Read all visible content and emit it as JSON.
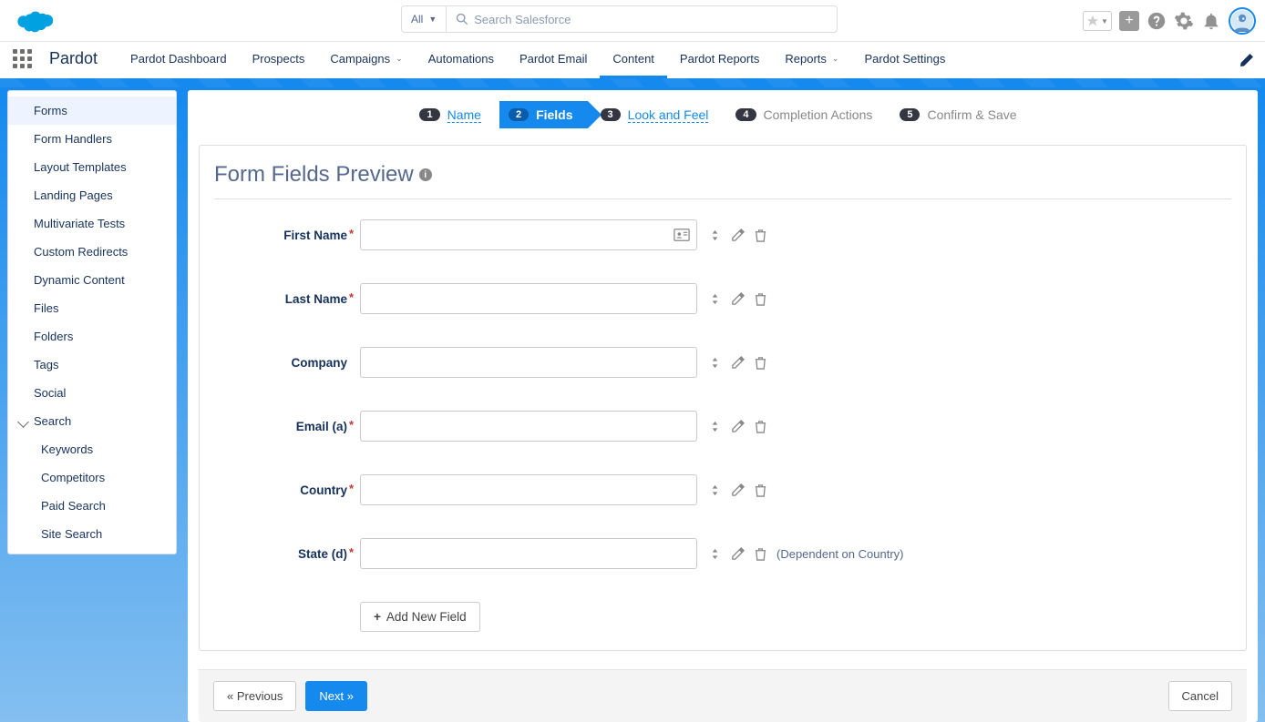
{
  "header": {
    "search_scope": "All",
    "search_placeholder": "Search Salesforce"
  },
  "nav": {
    "app_name": "Pardot",
    "items": [
      {
        "label": "Pardot Dashboard",
        "dropdown": false,
        "active": false
      },
      {
        "label": "Prospects",
        "dropdown": false,
        "active": false
      },
      {
        "label": "Campaigns",
        "dropdown": true,
        "active": false
      },
      {
        "label": "Automations",
        "dropdown": false,
        "active": false
      },
      {
        "label": "Pardot Email",
        "dropdown": false,
        "active": false
      },
      {
        "label": "Content",
        "dropdown": false,
        "active": true
      },
      {
        "label": "Pardot Reports",
        "dropdown": false,
        "active": false
      },
      {
        "label": "Reports",
        "dropdown": true,
        "active": false
      },
      {
        "label": "Pardot Settings",
        "dropdown": false,
        "active": false
      }
    ]
  },
  "sidebar": {
    "items": [
      {
        "label": "Forms",
        "active": true
      },
      {
        "label": "Form Handlers"
      },
      {
        "label": "Layout Templates"
      },
      {
        "label": "Landing Pages"
      },
      {
        "label": "Multivariate Tests"
      },
      {
        "label": "Custom Redirects"
      },
      {
        "label": "Dynamic Content"
      },
      {
        "label": "Files"
      },
      {
        "label": "Folders"
      },
      {
        "label": "Tags"
      },
      {
        "label": "Social"
      }
    ],
    "group_label": "Search",
    "sub_items": [
      {
        "label": "Keywords"
      },
      {
        "label": "Competitors"
      },
      {
        "label": "Paid Search"
      },
      {
        "label": "Site Search"
      }
    ]
  },
  "wizard": {
    "steps": [
      {
        "num": "1",
        "label": "Name",
        "state": "link"
      },
      {
        "num": "2",
        "label": "Fields",
        "state": "active"
      },
      {
        "num": "3",
        "label": "Look and Feel",
        "state": "link"
      },
      {
        "num": "4",
        "label": "Completion Actions",
        "state": "muted"
      },
      {
        "num": "5",
        "label": "Confirm & Save",
        "state": "muted"
      }
    ]
  },
  "card": {
    "title": "Form Fields Preview",
    "fields": [
      {
        "label": "First Name",
        "required": true,
        "has_contact_icon": true,
        "note": ""
      },
      {
        "label": "Last Name",
        "required": true,
        "note": ""
      },
      {
        "label": "Company",
        "required": false,
        "note": ""
      },
      {
        "label": "Email (a)",
        "required": true,
        "note": ""
      },
      {
        "label": "Country",
        "required": true,
        "note": ""
      },
      {
        "label": "State (d)",
        "required": true,
        "note": "(Dependent on Country)"
      }
    ],
    "add_button": "Add New Field"
  },
  "footer": {
    "prev": "« Previous",
    "next": "Next »",
    "cancel": "Cancel"
  }
}
